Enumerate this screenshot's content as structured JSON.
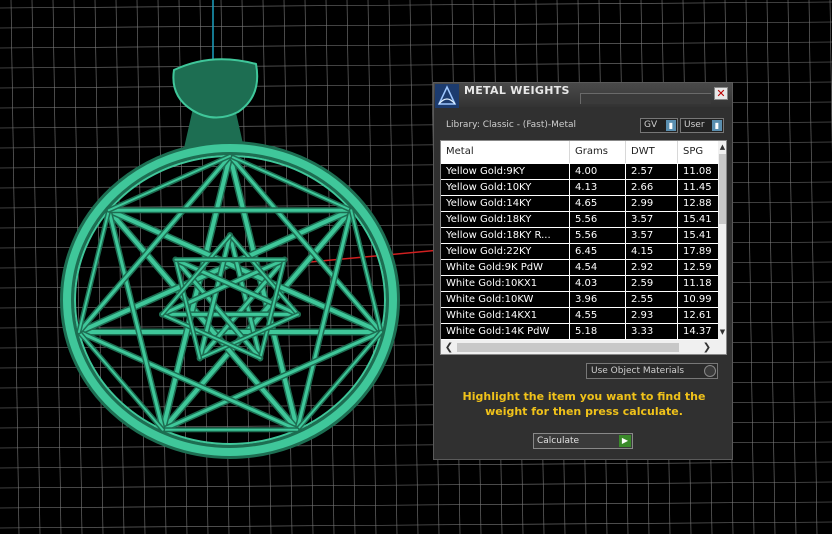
{
  "viewport": {
    "background": "#000000",
    "grid_color": "#7a7a7a",
    "model_color": "#3fc79a",
    "model_shadow": "#1d6e52",
    "axis_x_color": "#d02020",
    "axis_y_color": "#1aa0c0"
  },
  "dialog": {
    "title": "METAL WEIGHTS",
    "close_label": "✕",
    "library_label": "Library: Classic - (Fast)-Metal",
    "unit_select": "GV",
    "user_select": "User",
    "table": {
      "columns": [
        "Metal",
        "Grams",
        "DWT",
        "SPG"
      ],
      "rows": [
        [
          "Yellow Gold:9KY",
          "4.00",
          "2.57",
          "11.08"
        ],
        [
          "Yellow Gold:10KY",
          "4.13",
          "2.66",
          "11.45"
        ],
        [
          "Yellow Gold:14KY",
          "4.65",
          "2.99",
          "12.88"
        ],
        [
          "Yellow Gold:18KY",
          "5.56",
          "3.57",
          "15.41"
        ],
        [
          "Yellow Gold:18KY R...",
          "5.56",
          "3.57",
          "15.41"
        ],
        [
          "Yellow Gold:22KY",
          "6.45",
          "4.15",
          "17.89"
        ],
        [
          "White Gold:9K PdW",
          "4.54",
          "2.92",
          "12.59"
        ],
        [
          "White Gold:10KX1",
          "4.03",
          "2.59",
          "11.18"
        ],
        [
          "White Gold:10KW",
          "3.96",
          "2.55",
          "10.99"
        ],
        [
          "White Gold:14KX1",
          "4.55",
          "2.93",
          "12.61"
        ],
        [
          "White Gold:14K PdW",
          "5.18",
          "3.33",
          "14.37"
        ]
      ]
    },
    "use_object_materials": "Use Object Materials",
    "hint": "Highlight the item you want to find the weight for then press calculate.",
    "calculate_label": "Calculate"
  }
}
